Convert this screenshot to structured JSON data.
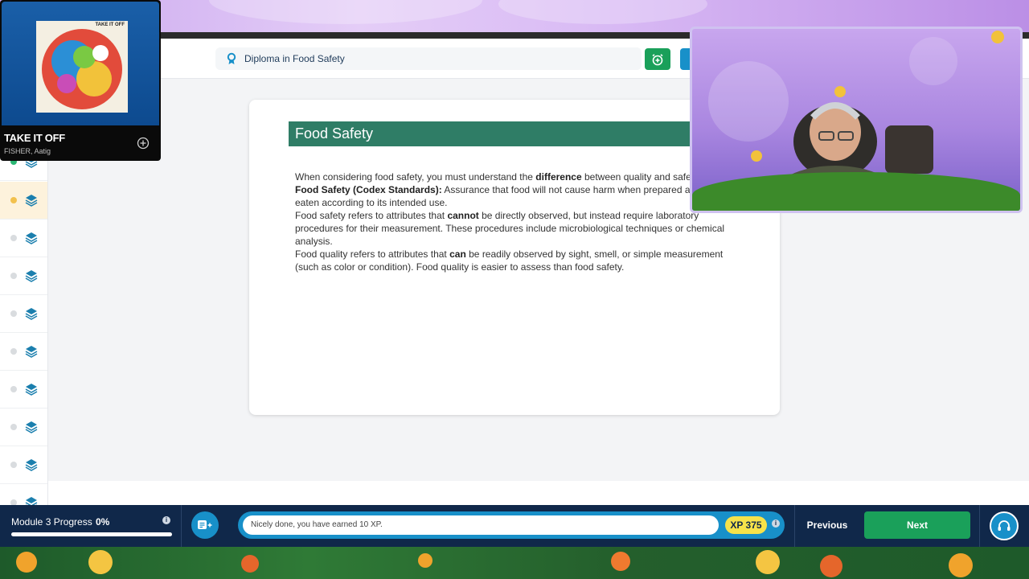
{
  "header": {
    "course_title": "Diploma in Food Safety",
    "icons": [
      "ribbon-icon",
      "alarm-icon",
      "bookmark-icon"
    ]
  },
  "sidebar": {
    "items": [
      {
        "status": "done"
      },
      {
        "status": "current"
      },
      {
        "status": "locked"
      },
      {
        "status": "locked"
      },
      {
        "status": "locked"
      },
      {
        "status": "locked"
      },
      {
        "status": "locked"
      },
      {
        "status": "locked"
      },
      {
        "status": "locked"
      },
      {
        "status": "locked"
      }
    ]
  },
  "lesson": {
    "title": "Food Safety",
    "intro_a": "When considering food safety, you must understand the ",
    "intro_b": "difference",
    "intro_c": " between quality and safety.",
    "codex_label": "Food Safety (Codex Standards):",
    "codex_text": " Assurance that food will not cause harm when prepared and/or eaten according to its intended use.",
    "safety_a": "Food safety refers to attributes that ",
    "safety_b": "cannot",
    "safety_c": " be directly observed, but instead require laboratory procedures for their measurement. These procedures include microbiological techniques or chemical analysis.",
    "quality_a": "Food quality refers to attributes that ",
    "quality_b": "can",
    "quality_c": " be readily observed by sight, smell, or simple measurement (such as color or condition). Food quality is easier to assess than food safety."
  },
  "music": {
    "title": "TAKE IT OFF",
    "artist": "FISHER, Aatig",
    "album_text": "TAKE IT OFF"
  },
  "bottom_bar": {
    "progress_label": "Module 3 Progress",
    "progress_value": "0%",
    "progress_fraction": 0,
    "message": "Nicely done, you have earned 10 XP.",
    "xp": "XP 375",
    "previous_label": "Previous",
    "next_label": "Next"
  },
  "colors": {
    "accent_green": "#1aa05a",
    "lesson_header": "#2f7d66",
    "navy": "#10284a",
    "teal": "#1890c9",
    "xp_yellow": "#f6e24a"
  }
}
